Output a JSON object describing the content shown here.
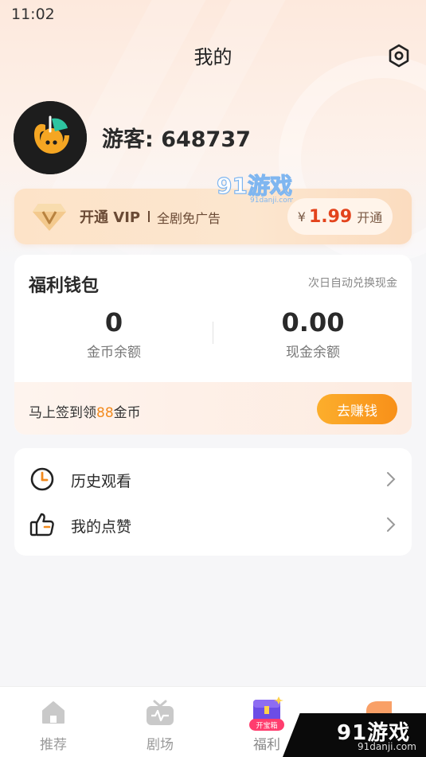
{
  "status_bar": {
    "time": "11:02"
  },
  "header": {
    "title": "我的",
    "settings_icon": "settings-hexagon-icon"
  },
  "profile": {
    "username": "游客: 648737",
    "avatar_icon": "app-logo-avatar"
  },
  "watermark": {
    "text": "91游戏",
    "sub": "91danji.com"
  },
  "vip": {
    "label": "开通 VIP",
    "subtitle": "全剧免广告",
    "currency": "¥",
    "price": "1.99",
    "action": "开通",
    "icon": "vip-diamond-icon"
  },
  "wallet": {
    "title": "福利钱包",
    "note": "次日自动兑换现金",
    "coins": {
      "value": "0",
      "label": "金币余额"
    },
    "cash": {
      "value": "0.00",
      "label": "现金余额"
    },
    "signin": {
      "prefix": "马上签到领",
      "amount": "88",
      "suffix": "金币"
    },
    "earn_button": "去赚钱"
  },
  "menu": [
    {
      "label": "历史观看",
      "icon": "clock-icon"
    },
    {
      "label": "我的点赞",
      "icon": "thumbs-up-icon"
    }
  ],
  "tabs": [
    {
      "label": "推荐",
      "icon": "home-icon"
    },
    {
      "label": "剧场",
      "icon": "tv-icon"
    },
    {
      "label": "福利",
      "icon": "treasure-chest-icon",
      "badge": "开宝箱"
    },
    {
      "label": "",
      "icon": "profile-tab-icon"
    }
  ],
  "corner_logo": {
    "text": "91游戏",
    "sub": "91danji.com"
  },
  "colors": {
    "accent": "#f89019",
    "price": "#e3431c",
    "highlight": "#f28a1e"
  }
}
